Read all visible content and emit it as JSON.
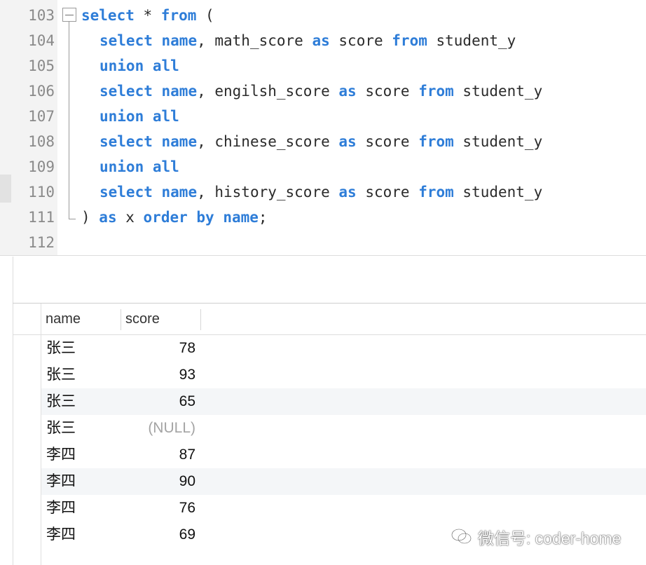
{
  "editor": {
    "lines": [
      {
        "no": "103",
        "tokens": [
          {
            "t": "select",
            "k": 1
          },
          {
            "t": " * ",
            "k": 0
          },
          {
            "t": "from",
            "k": 1
          },
          {
            "t": " (",
            "k": 0
          }
        ]
      },
      {
        "no": "104",
        "tokens": [
          {
            "t": "select",
            "k": 1
          },
          {
            "t": " ",
            "k": 0
          },
          {
            "t": "name",
            "k": 1
          },
          {
            "t": ", math_score ",
            "k": 0
          },
          {
            "t": "as",
            "k": 1
          },
          {
            "t": " score ",
            "k": 0
          },
          {
            "t": "from",
            "k": 1
          },
          {
            "t": " student_y",
            "k": 0
          }
        ]
      },
      {
        "no": "105",
        "tokens": [
          {
            "t": "union all",
            "k": 1
          }
        ]
      },
      {
        "no": "106",
        "tokens": [
          {
            "t": "select",
            "k": 1
          },
          {
            "t": " ",
            "k": 0
          },
          {
            "t": "name",
            "k": 1
          },
          {
            "t": ", engilsh_score ",
            "k": 0
          },
          {
            "t": "as",
            "k": 1
          },
          {
            "t": " score ",
            "k": 0
          },
          {
            "t": "from",
            "k": 1
          },
          {
            "t": " student_y",
            "k": 0
          }
        ]
      },
      {
        "no": "107",
        "tokens": [
          {
            "t": "union all",
            "k": 1
          }
        ]
      },
      {
        "no": "108",
        "tokens": [
          {
            "t": "select",
            "k": 1
          },
          {
            "t": " ",
            "k": 0
          },
          {
            "t": "name",
            "k": 1
          },
          {
            "t": ", chinese_score ",
            "k": 0
          },
          {
            "t": "as",
            "k": 1
          },
          {
            "t": " score ",
            "k": 0
          },
          {
            "t": "from",
            "k": 1
          },
          {
            "t": " student_y",
            "k": 0
          }
        ]
      },
      {
        "no": "109",
        "tokens": [
          {
            "t": "union all",
            "k": 1
          }
        ]
      },
      {
        "no": "110",
        "tokens": [
          {
            "t": "select",
            "k": 1
          },
          {
            "t": " ",
            "k": 0
          },
          {
            "t": "name",
            "k": 1
          },
          {
            "t": ", history_score ",
            "k": 0
          },
          {
            "t": "as",
            "k": 1
          },
          {
            "t": " score ",
            "k": 0
          },
          {
            "t": "from",
            "k": 1
          },
          {
            "t": " student_y",
            "k": 0
          }
        ]
      },
      {
        "no": "111",
        "tokens": [
          {
            "t": ") ",
            "k": 0
          },
          {
            "t": "as",
            "k": 1
          },
          {
            "t": " x ",
            "k": 0
          },
          {
            "t": "order by",
            "k": 1
          },
          {
            "t": " ",
            "k": 0
          },
          {
            "t": "name",
            "k": 1
          },
          {
            "t": ";",
            "k": 0
          }
        ]
      },
      {
        "no": "112",
        "tokens": []
      }
    ]
  },
  "results": {
    "columns": [
      "name",
      "score"
    ],
    "rows": [
      {
        "name": "张三",
        "score": "78"
      },
      {
        "name": "张三",
        "score": "93"
      },
      {
        "name": "张三",
        "score": "65"
      },
      {
        "name": "张三",
        "score": "(NULL)"
      },
      {
        "name": "李四",
        "score": "87"
      },
      {
        "name": "李四",
        "score": "90"
      },
      {
        "name": "李四",
        "score": "76"
      },
      {
        "name": "李四",
        "score": "69"
      }
    ]
  },
  "watermark": {
    "text": "微信号: coder-home",
    "icon": "wechat-icon"
  },
  "colors": {
    "keyword": "#2e7dd8",
    "null_value": "#a4a4a4",
    "alt_row": "#f4f6f8"
  }
}
